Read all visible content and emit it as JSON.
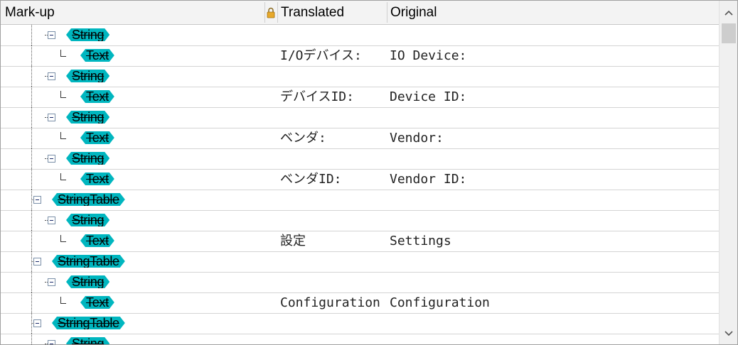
{
  "header": {
    "markup_label": "Mark-up",
    "translated_label": "Translated",
    "original_label": "Original"
  },
  "rows": [
    {
      "node": "String",
      "translated": "",
      "original": ""
    },
    {
      "node": "Text",
      "translated": "I/Oデバイス:",
      "original": "IO Device:"
    },
    {
      "node": "String",
      "translated": "",
      "original": ""
    },
    {
      "node": "Text",
      "translated": "デバイスID:",
      "original": "Device ID:"
    },
    {
      "node": "String",
      "translated": "",
      "original": ""
    },
    {
      "node": "Text",
      "translated": "ベンダ:",
      "original": "Vendor:"
    },
    {
      "node": "String",
      "translated": "",
      "original": ""
    },
    {
      "node": "Text",
      "translated": "ベンダID:",
      "original": "Vendor ID:"
    },
    {
      "node": "StringTable",
      "translated": "",
      "original": ""
    },
    {
      "node": "String",
      "translated": "",
      "original": ""
    },
    {
      "node": "Text",
      "translated": "設定",
      "original": "Settings"
    },
    {
      "node": "StringTable",
      "translated": "",
      "original": ""
    },
    {
      "node": "String",
      "translated": "",
      "original": ""
    },
    {
      "node": "Text",
      "translated": "Configuration",
      "original": "Configuration"
    },
    {
      "node": "StringTable",
      "translated": "",
      "original": ""
    },
    {
      "node": "String",
      "translated": "",
      "original": ""
    }
  ],
  "icons": {
    "lock": "lock-icon",
    "expander": "collapse-minus-icon",
    "scroll_up": "chevron-up-icon",
    "scroll_down": "chevron-down-icon"
  },
  "colors": {
    "tag_fill": "#00b6bf",
    "header_bg": "#f3f3f3"
  }
}
